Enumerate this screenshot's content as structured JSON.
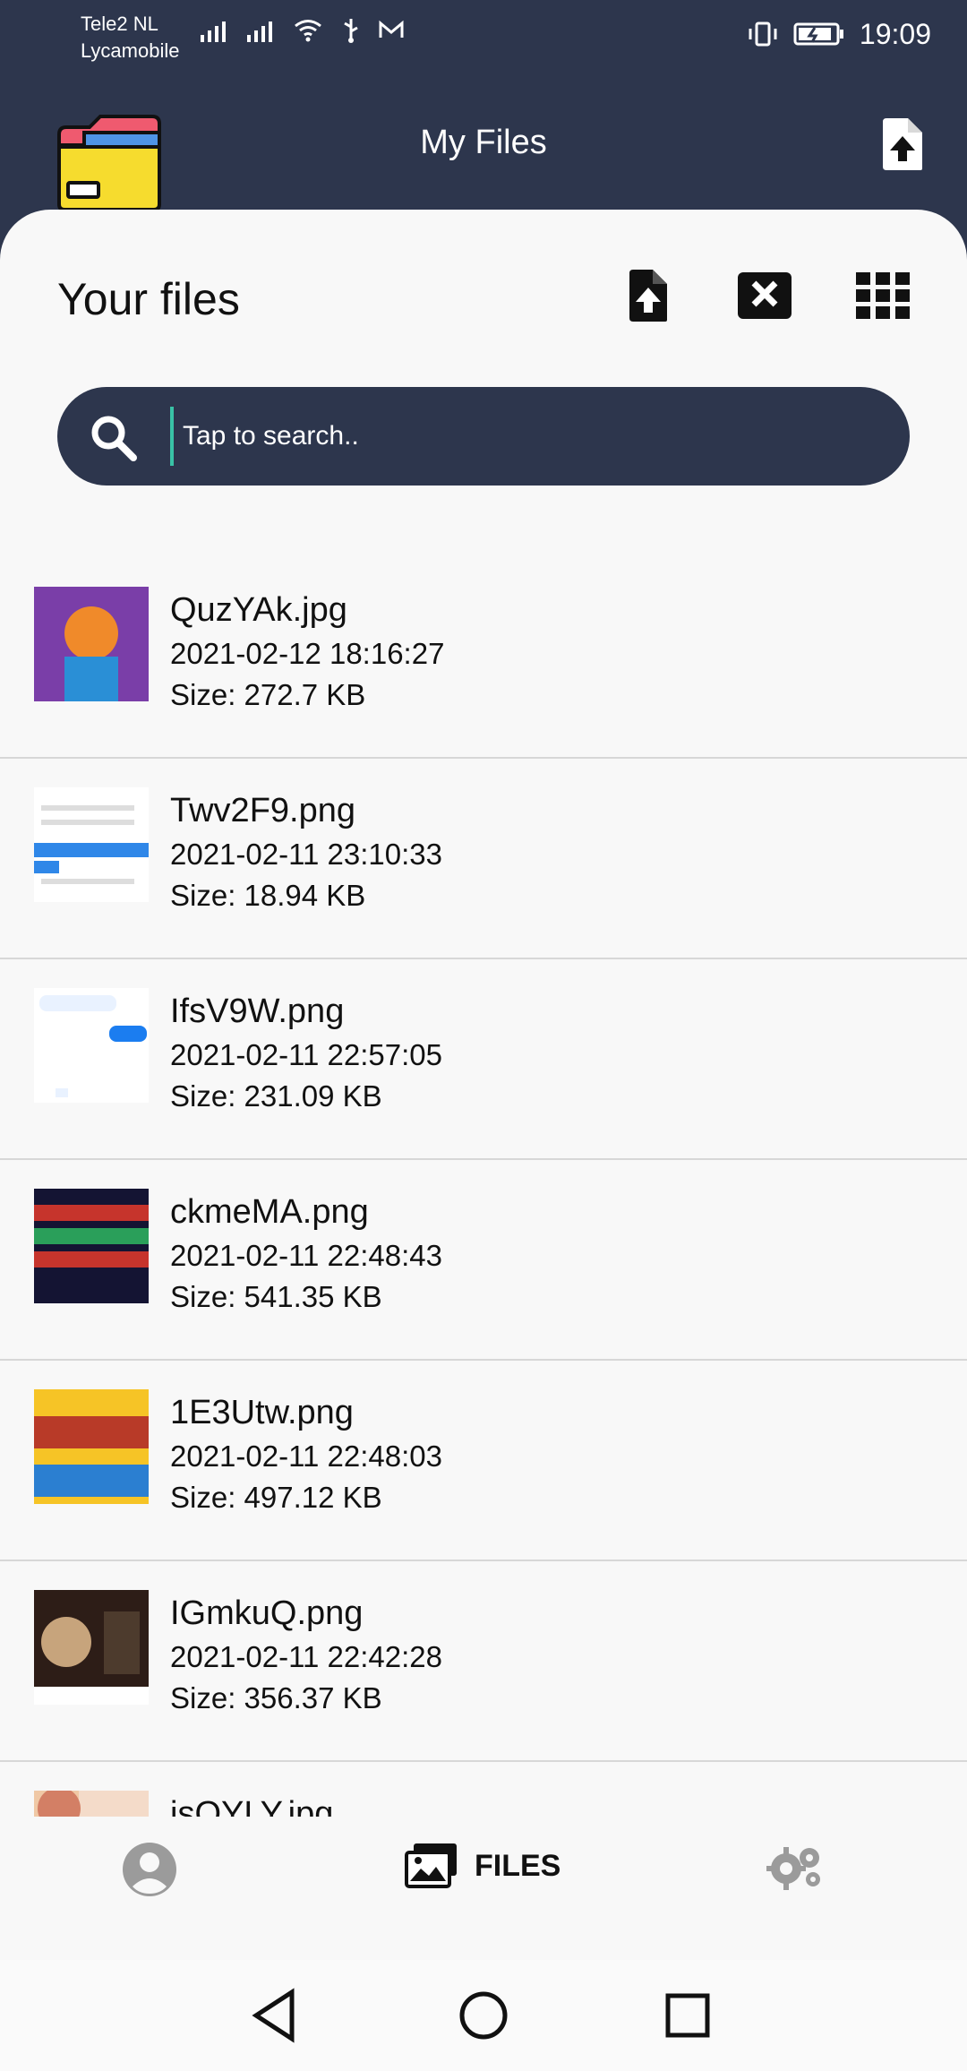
{
  "status_bar": {
    "carrier_1": "Tele2 NL",
    "carrier_2": "Lycamobile",
    "time": "19:09"
  },
  "app_bar": {
    "title": "My Files"
  },
  "files_section": {
    "title": "Your files"
  },
  "search": {
    "placeholder": "Tap to search.."
  },
  "files": [
    {
      "name": "QuzYAk.jpg",
      "date": "2021-02-12 18:16:27",
      "size": "Size: 272.7 KB",
      "thumb_colors": [
        "#7a3ea8",
        "#f08a2a",
        "#2a8fd6"
      ]
    },
    {
      "name": "Twv2F9.png",
      "date": "2021-02-11 23:10:33",
      "size": "Size: 18.94 KB",
      "thumb_colors": [
        "#ffffff",
        "#2f87e8",
        "#dddddd"
      ]
    },
    {
      "name": "IfsV9W.png",
      "date": "2021-02-11 22:57:05",
      "size": "Size: 231.09 KB",
      "thumb_colors": [
        "#ffffff",
        "#e9f2ff",
        "#1b7df0"
      ]
    },
    {
      "name": "ckmeMA.png",
      "date": "2021-02-11 22:48:43",
      "size": "Size: 541.35 KB",
      "thumb_colors": [
        "#141433",
        "#c6342c",
        "#2a9f5a"
      ]
    },
    {
      "name": "1E3Utw.png",
      "date": "2021-02-11 22:48:03",
      "size": "Size: 497.12 KB",
      "thumb_colors": [
        "#f6c426",
        "#b83a28",
        "#2b7fd1"
      ]
    },
    {
      "name": "IGmkuQ.png",
      "date": "2021-02-11 22:42:28",
      "size": "Size: 356.37 KB",
      "thumb_colors": [
        "#2d1d17",
        "#c7a47c",
        "#4d3b2d"
      ]
    },
    {
      "name": "isOYLY.jpg",
      "date": "",
      "size": "",
      "thumb_colors": [
        "#f0c8a5",
        "#d37f65",
        "#f4dbc9"
      ]
    }
  ],
  "bottom_nav": {
    "files_label": "FILES"
  },
  "colors": {
    "header_bg": "#2d364d",
    "content_bg": "#f8f8f8",
    "accent": "#39c2a6",
    "folder_yellow": "#f6dc2e",
    "folder_red": "#ef5a6f",
    "folder_blue": "#4f94e6"
  },
  "icons": {
    "upload": "upload-file-icon",
    "clear": "close-square-icon",
    "grid": "grid-view-icon",
    "search": "search-icon",
    "profile": "profile-icon",
    "files": "gallery-icon",
    "settings": "gear-icon",
    "back": "back-icon",
    "home": "home-icon",
    "recent": "recent-apps-icon"
  }
}
